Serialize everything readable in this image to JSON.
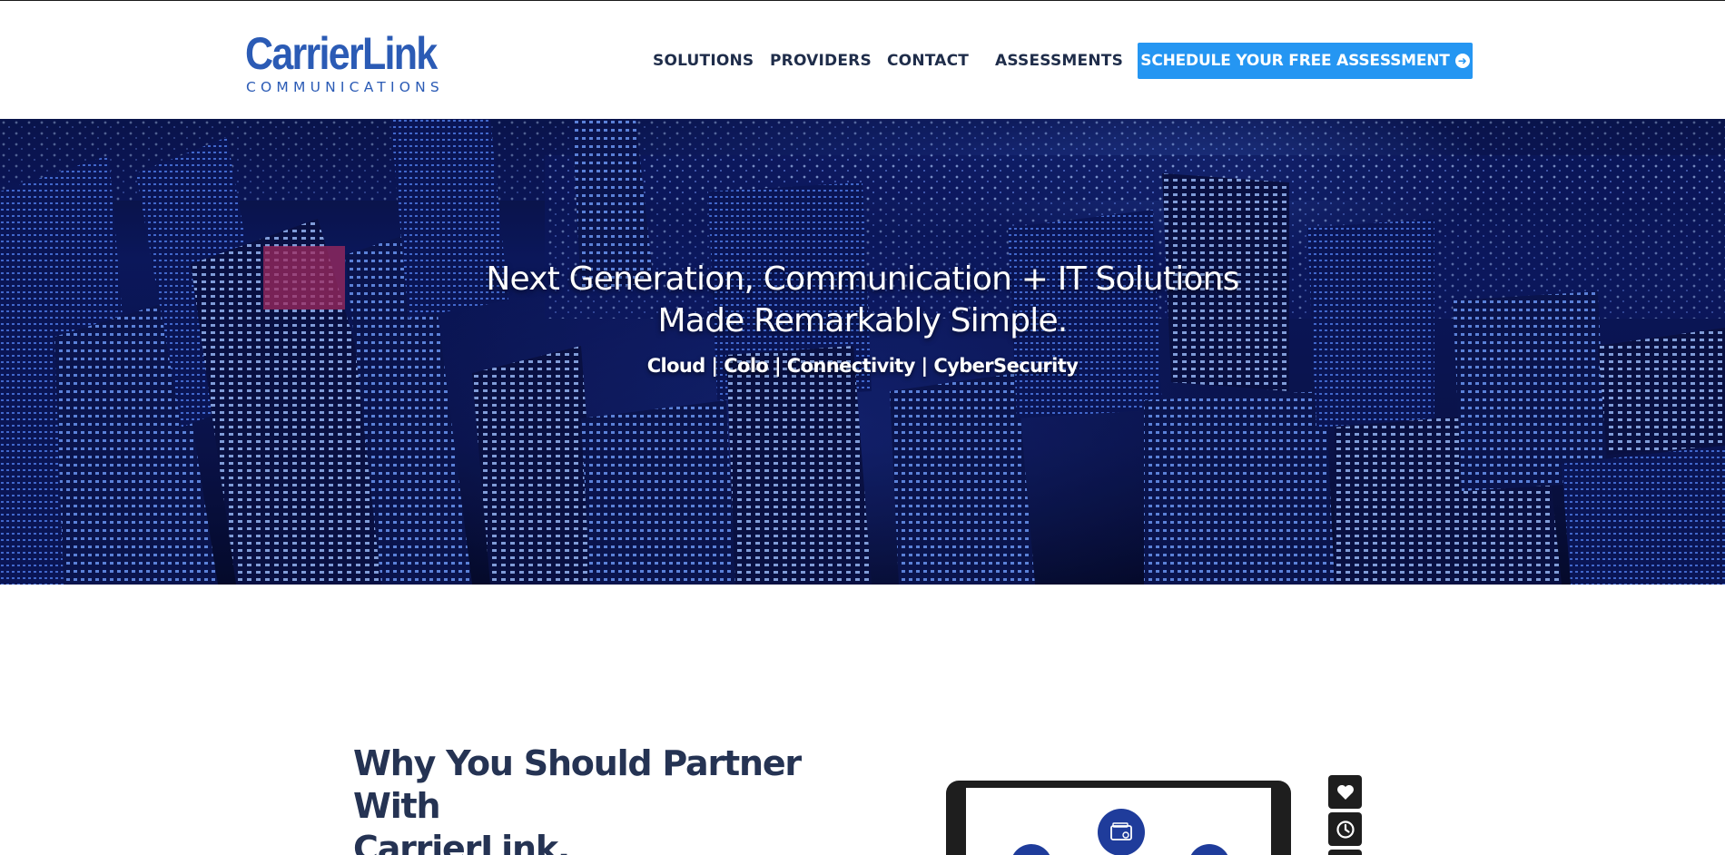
{
  "header": {
    "logo": {
      "main": "CarrierLink",
      "sub": "COMMUNICATIONS"
    },
    "nav": [
      {
        "label": "SOLUTIONS"
      },
      {
        "label": "PROVIDERS"
      },
      {
        "label": "CONTACT"
      },
      {
        "label": "ASSESSMENTS"
      }
    ],
    "cta": {
      "label": "SCHEDULE YOUR FREE ASSESSMENT",
      "icon": "arrow-circle-right-icon"
    }
  },
  "hero": {
    "title_line1": "Next Generation, Communication + IT Solutions",
    "title_line2": "Made Remarkably Simple.",
    "subtitle": "Cloud | Colo | Connectivity | CyberSecurity"
  },
  "why": {
    "heading_line1": "Why You Should Partner With",
    "heading_line2": "CarrierLink."
  },
  "side_buttons": [
    {
      "icon": "heart-icon"
    },
    {
      "icon": "clock-icon"
    },
    {
      "icon": "more-icon"
    }
  ],
  "colors": {
    "brand_blue": "#2b5bb5",
    "cta_blue": "#2596f2",
    "heading_navy": "#253353",
    "nav_text": "#1f2d4a"
  }
}
